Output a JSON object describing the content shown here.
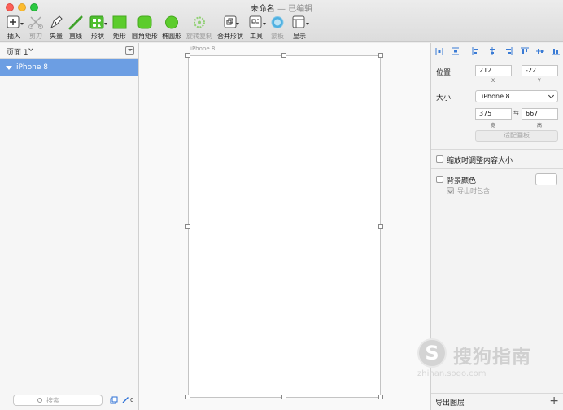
{
  "window": {
    "title": "未命名",
    "edited": "— 已编辑"
  },
  "toolbar": {
    "insert": "插入",
    "scissors": "剪刀",
    "vector": "矢量",
    "line": "直线",
    "shape": "形状",
    "rectangle": "矩形",
    "rounded_rect": "圆角矩形",
    "oval": "椭圆形",
    "rotate_copy": "旋转复制",
    "combine": "合并形状",
    "tools": "工具",
    "mask": "蒙板",
    "display": "显示"
  },
  "sidebar": {
    "page": "页面 1",
    "layer": "iPhone 8",
    "search_placeholder": "搜索",
    "count": "0"
  },
  "canvas": {
    "artboard_label": "iPhone 8"
  },
  "inspector": {
    "position_label": "位置",
    "pos_x": "212",
    "pos_y": "-22",
    "x_label": "X",
    "y_label": "Y",
    "size_label": "大小",
    "preset": "iPhone 8",
    "width": "375",
    "height": "667",
    "width_label": "宽",
    "height_label": "高",
    "fit_button": "适配画板",
    "resize_content": "缩放时调整内容大小",
    "background_color": "背景颜色",
    "include_in_export": "导出时包含",
    "bg_swatch": "#ffffff",
    "export_layer": "导出图层",
    "export_add": "+"
  },
  "watermark": {
    "brand": "搜狗指南",
    "url": "zhinan.sogo.com"
  }
}
